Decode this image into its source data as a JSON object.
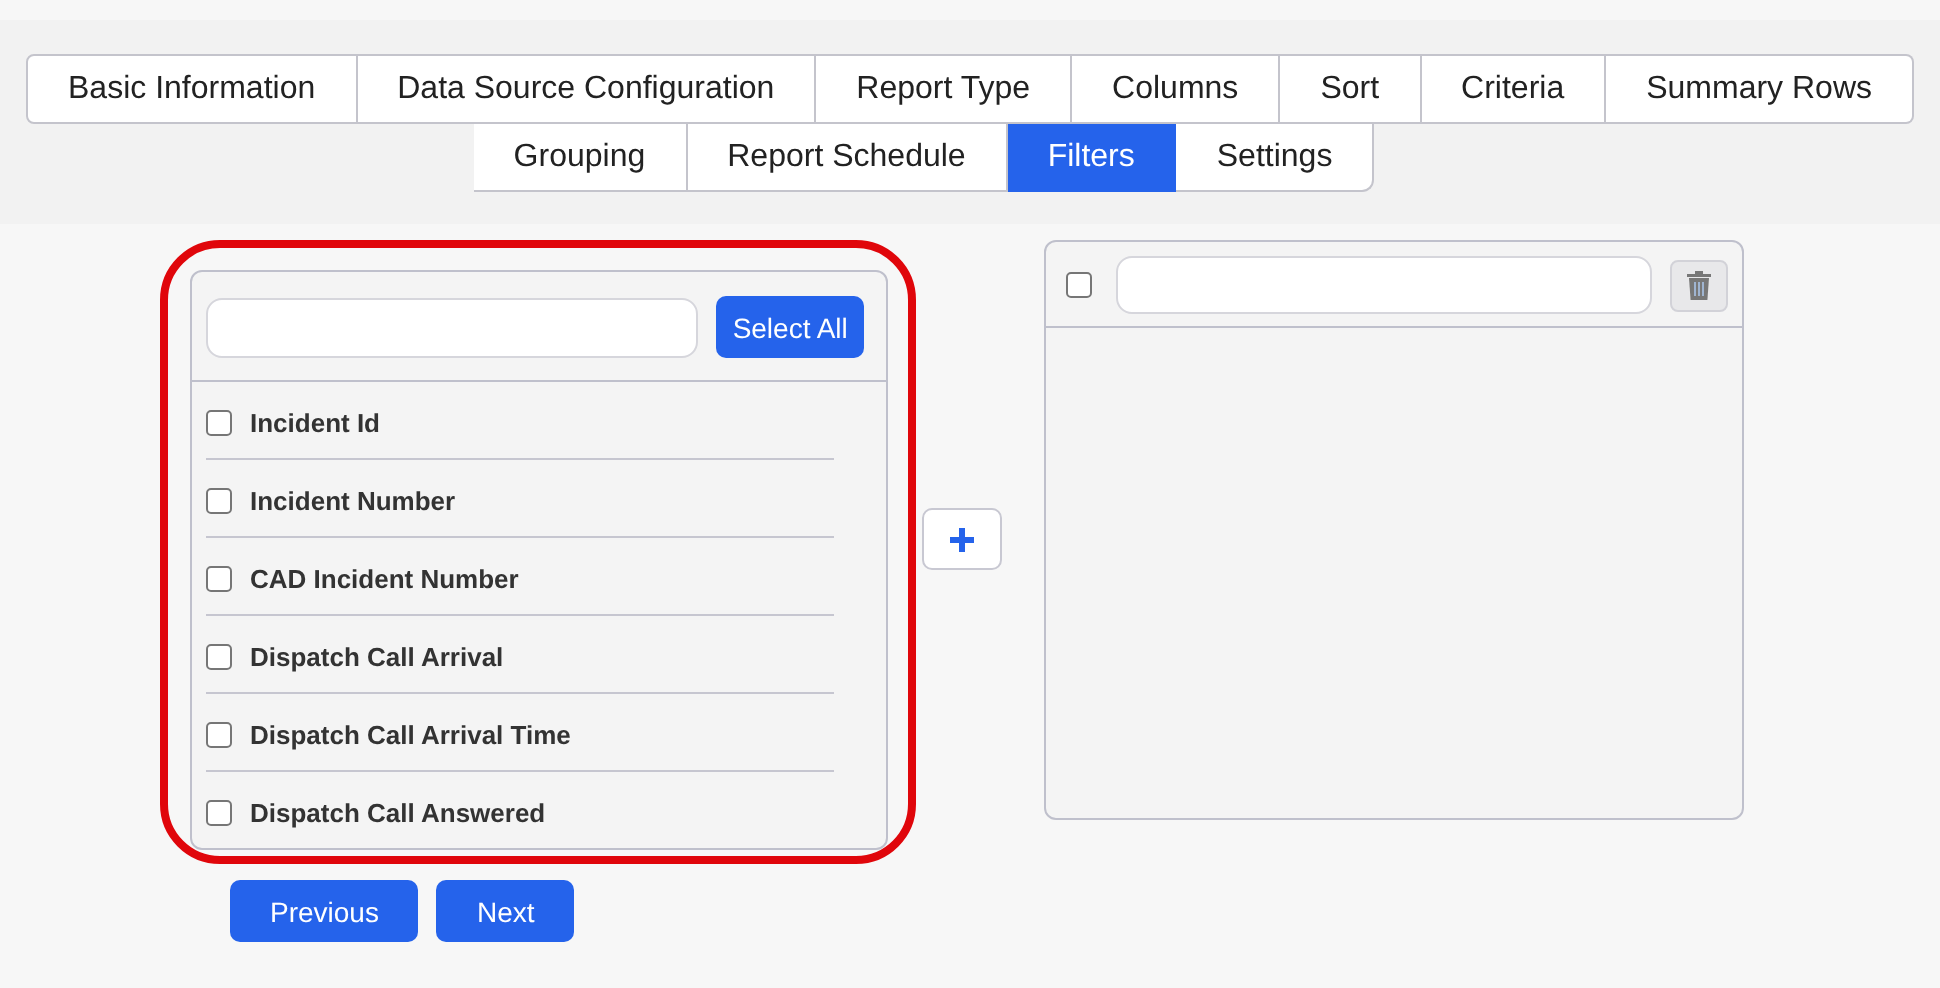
{
  "tab_rows": [
    {
      "tabs": [
        {
          "label": "Basic Information",
          "selected": false
        },
        {
          "label": "Data Source Configuration",
          "selected": false
        },
        {
          "label": "Report Type",
          "selected": false
        },
        {
          "label": "Columns",
          "selected": false
        },
        {
          "label": "Sort",
          "selected": false
        },
        {
          "label": "Criteria",
          "selected": false
        },
        {
          "label": "Summary Rows",
          "selected": false
        }
      ]
    },
    {
      "tabs": [
        {
          "label": "Grouping",
          "selected": false
        },
        {
          "label": "Report Schedule",
          "selected": false
        },
        {
          "label": "Filters",
          "selected": true
        },
        {
          "label": "Settings",
          "selected": false
        }
      ]
    }
  ],
  "left_panel": {
    "select_all_button": "Select All",
    "items": [
      {
        "label": "Incident Id",
        "checked": false
      },
      {
        "label": "Incident Number",
        "checked": false
      },
      {
        "label": "CAD Incident Number",
        "checked": false
      },
      {
        "label": "Dispatch Call Arrival",
        "checked": false
      },
      {
        "label": "Dispatch Call Arrival Time",
        "checked": false
      },
      {
        "label": "Dispatch Call Answered",
        "checked": false
      }
    ]
  },
  "right_panel": {
    "checked": false
  },
  "nav_buttons": [
    "Previous",
    "Next"
  ]
}
